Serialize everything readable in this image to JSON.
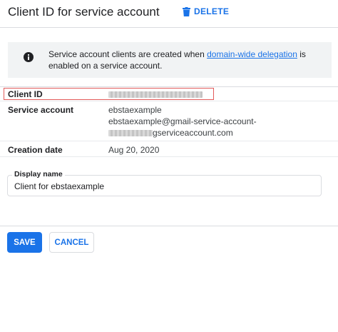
{
  "header": {
    "title": "Client ID for service account",
    "delete_label": "DELETE",
    "delete_icon": "trash-icon"
  },
  "info": {
    "icon": "info-icon",
    "text_before": "Service account clients are created when ",
    "link_text": "domain-wide delegation",
    "text_after": " is enabled on a service account."
  },
  "details": {
    "client_id_label": "Client ID",
    "service_account_label": "Service account",
    "service_account_line1": "ebstaexample",
    "service_account_line2": "ebstaexample@gmail-service-account-",
    "service_account_line3": "gserviceaccount.com",
    "creation_date_label": "Creation date",
    "creation_date_value": "Aug 20, 2020"
  },
  "display_name": {
    "label": "Display name",
    "value": "Client for ebstaexample"
  },
  "actions": {
    "save_label": "SAVE",
    "cancel_label": "CANCEL"
  },
  "colors": {
    "accent": "#1a73e8",
    "highlight": "#e25b5b",
    "info_bg": "#f1f3f4"
  }
}
